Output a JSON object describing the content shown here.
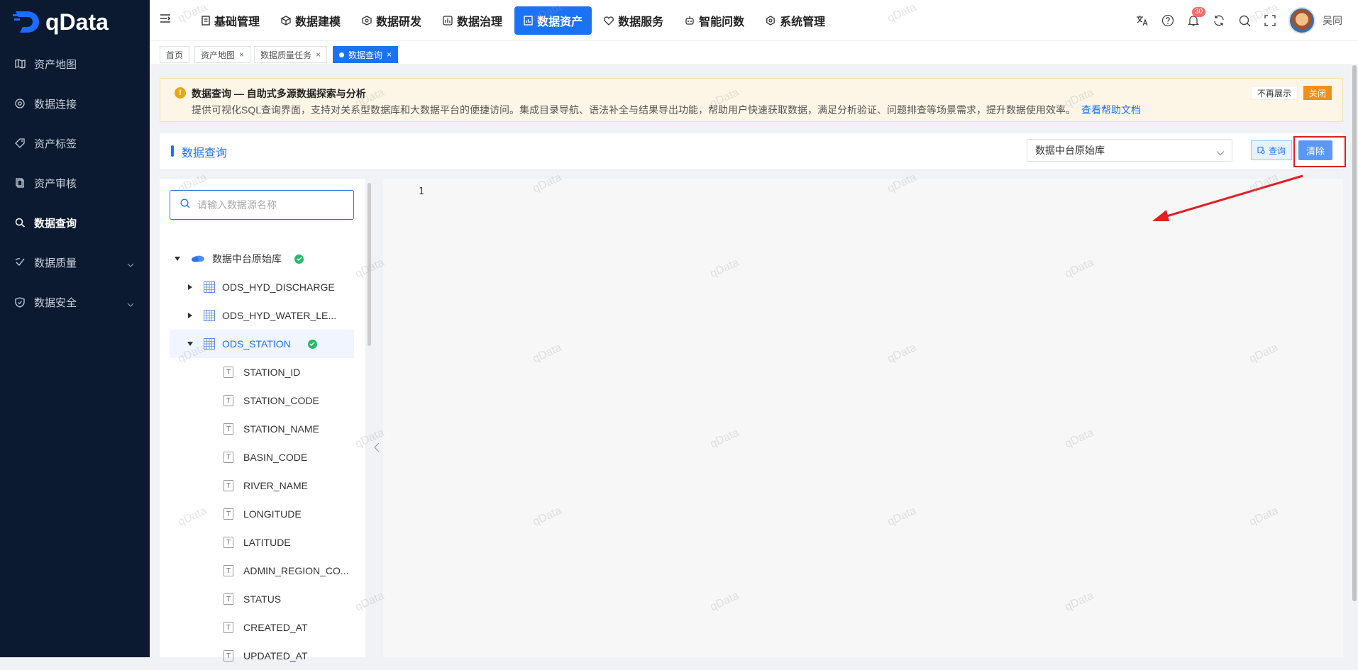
{
  "brand": {
    "name": "qData"
  },
  "sidebar": {
    "items": [
      {
        "label": "资产地图",
        "icon": "map-icon"
      },
      {
        "label": "数据连接",
        "icon": "connect-icon"
      },
      {
        "label": "资产标签",
        "icon": "tag-icon"
      },
      {
        "label": "资产审核",
        "icon": "audit-icon"
      },
      {
        "label": "数据查询",
        "icon": "query-icon",
        "active": true
      },
      {
        "label": "数据质量",
        "icon": "quality-icon",
        "expandable": true
      },
      {
        "label": "数据安全",
        "icon": "shield-icon",
        "expandable": true
      }
    ]
  },
  "topnav": {
    "items": [
      {
        "label": "基础管理"
      },
      {
        "label": "数据建模"
      },
      {
        "label": "数据研发"
      },
      {
        "label": "数据治理"
      },
      {
        "label": "数据资产",
        "active": true
      },
      {
        "label": "数据服务"
      },
      {
        "label": "智能问数"
      },
      {
        "label": "系统管理"
      }
    ],
    "notification_count": "30",
    "username": "吴同"
  },
  "tabs": [
    {
      "label": "首页"
    },
    {
      "label": "资产地图",
      "closable": true
    },
    {
      "label": "数据质量任务",
      "closable": true
    },
    {
      "label": "数据查询",
      "closable": true,
      "active": true
    }
  ],
  "notice": {
    "title": "数据查询 — 自助式多源数据探索与分析",
    "desc": "提供可视化SQL查询界面，支持对关系型数据库和大数据平台的便捷访问。集成目录导航、语法补全与结果导出功能，帮助用户快速获取数据，满足分析验证、问题排查等场景需求，提升数据使用效率。",
    "link": "查看帮助文档",
    "no_more": "不再展示",
    "close": "关闭"
  },
  "panel": {
    "title": "数据查询",
    "datasource": "数据中台原始库",
    "query_btn": "查询",
    "clear_btn": "清除"
  },
  "tree": {
    "search_placeholder": "请输入数据源名称",
    "root": "数据中台原始库",
    "tables": [
      "ODS_HYD_DISCHARGE",
      "ODS_HYD_WATER_LE...",
      "ODS_STATION"
    ],
    "columns": [
      "STATION_ID",
      "STATION_CODE",
      "STATION_NAME",
      "BASIN_CODE",
      "RIVER_NAME",
      "LONGITUDE",
      "LATITUDE",
      "ADMIN_REGION_CO...",
      "STATUS",
      "CREATED_AT",
      "UPDATED_AT"
    ]
  },
  "editor": {
    "line": "1"
  },
  "watermark": "qData",
  "colors": {
    "primary": "#1a73f5",
    "sidebar": "#0b1a30",
    "annotation": "#e51c23"
  }
}
